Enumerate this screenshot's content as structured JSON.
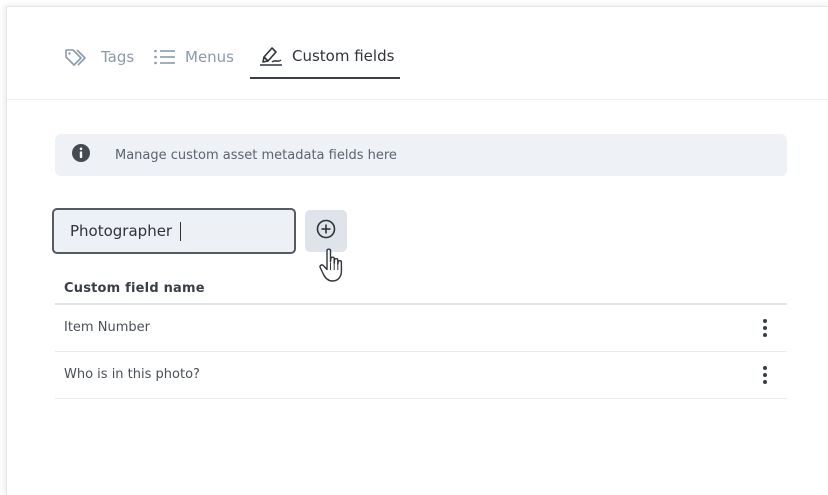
{
  "tabs": [
    {
      "label": "Tags",
      "icon": "tag-icon",
      "active": false
    },
    {
      "label": "Menus",
      "icon": "list-icon",
      "active": false
    },
    {
      "label": "Custom fields",
      "icon": "signature-icon",
      "active": true
    }
  ],
  "info": {
    "icon": "info-icon",
    "text": "Manage custom asset metadata fields here"
  },
  "new_field": {
    "value": "Photographer",
    "add_icon": "plus-circle-icon"
  },
  "table": {
    "column_header": "Custom field name",
    "rows": [
      {
        "name": "Item Number"
      },
      {
        "name": "Who is in this photo?"
      }
    ]
  },
  "colors": {
    "accent": "#3b4046",
    "tab_inactive": "#8a9aad",
    "info_bg": "#eef1f5",
    "button_bg": "#dfe4ea"
  }
}
